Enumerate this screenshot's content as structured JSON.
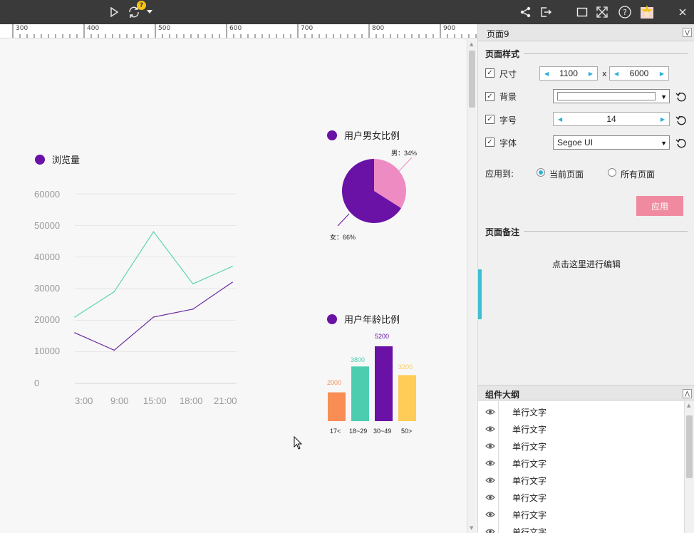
{
  "ruler": {
    "labels": [
      "300",
      "400",
      "500",
      "600",
      "700",
      "800",
      "900"
    ]
  },
  "views_chart": {
    "title": "浏览量",
    "y_ticks": [
      "60000",
      "50000",
      "40000",
      "30000",
      "20000",
      "10000",
      "0"
    ],
    "x_ticks": [
      "3:00",
      "9:00",
      "15:00",
      "18:00",
      "21:00"
    ]
  },
  "gender_chart": {
    "title": "用户男女比例",
    "male_label": "男：34%",
    "female_label": "女：66%"
  },
  "age_chart": {
    "title": "用户年龄比例",
    "value_labels": [
      "2000",
      "3800",
      "5200",
      "3200"
    ],
    "categories": [
      "17<",
      "18~29",
      "30~49",
      "50>"
    ]
  },
  "chart_data": [
    {
      "type": "line",
      "title": "浏览量",
      "x": [
        "3:00",
        "9:00",
        "15:00",
        "18:00",
        "21:00"
      ],
      "ylim": [
        0,
        60000
      ],
      "grid": true,
      "series": [
        {
          "color": "#5fd6ad",
          "values": [
            21000,
            29000,
            48000,
            31500,
            37000
          ]
        },
        {
          "color": "#6a2a9c",
          "values": [
            16000,
            10500,
            21000,
            23500,
            32000
          ]
        }
      ]
    },
    {
      "type": "pie",
      "title": "用户男女比例",
      "labels": [
        "男",
        "女"
      ],
      "values": [
        34,
        66
      ],
      "colors": [
        "#ee8bc3",
        "#6a11a6"
      ]
    },
    {
      "type": "bar",
      "title": "用户年龄比例",
      "categories": [
        "17<",
        "18~29",
        "30~49",
        "50>"
      ],
      "values": [
        2000,
        3800,
        5200,
        3200
      ],
      "colors": [
        "#f98e55",
        "#4ccdb0",
        "#6a11a6",
        "#ffcc58"
      ]
    }
  ],
  "panel": {
    "title": "页面9",
    "style_section": "页面样式",
    "size_label": "尺寸",
    "width_value": "1100",
    "times": "x",
    "height_value": "6000",
    "background_label": "背景",
    "font_size_label": "字号",
    "font_size_value": "14",
    "font_label": "字体",
    "font_value": "Segoe UI",
    "apply_to_label": "应用到:",
    "current_page": "当前页面",
    "all_pages": "所有页面",
    "apply_button": "应用",
    "notes_section": "页面备注",
    "notes_placeholder": "点击这里进行编辑",
    "outline_section": "组件大纲",
    "outline_items": [
      "单行文字",
      "单行文字",
      "单行文字",
      "单行文字",
      "单行文字",
      "单行文字",
      "单行文字",
      "单行文字"
    ]
  }
}
